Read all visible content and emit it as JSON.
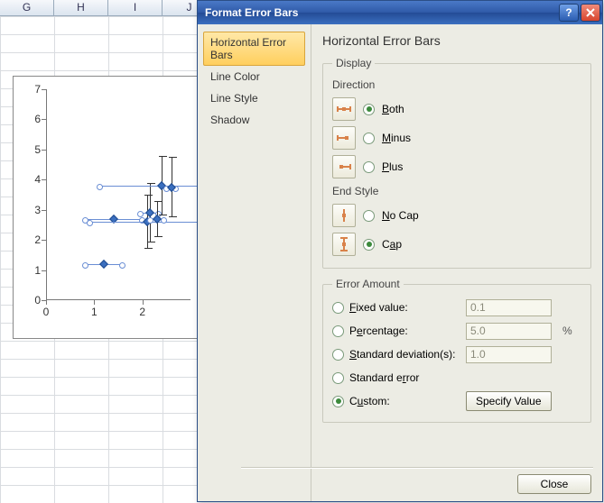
{
  "sheet": {
    "columns": [
      "G",
      "H",
      "I",
      "J"
    ]
  },
  "chart_data": {
    "type": "scatter",
    "xlim": [
      0,
      3
    ],
    "ylim": [
      0,
      7
    ],
    "xticks": [
      0,
      1,
      2
    ],
    "yticks": [
      0,
      1,
      2,
      3,
      4,
      5,
      6,
      7
    ],
    "points": [
      {
        "x": 1.2,
        "y": 1.2,
        "xerr": 0.4,
        "yerr": 0.0
      },
      {
        "x": 1.4,
        "y": 2.7,
        "xerr": 0.6,
        "yerr": 0.0
      },
      {
        "x": 2.1,
        "y": 2.6,
        "xerr": 1.2,
        "yerr": 0.9
      },
      {
        "x": 2.15,
        "y": 2.9,
        "xerr": 0.2,
        "yerr": 1.0
      },
      {
        "x": 2.3,
        "y": 2.7,
        "xerr": 0.15,
        "yerr": 0.6
      },
      {
        "x": 2.4,
        "y": 3.8,
        "xerr": 1.3,
        "yerr": 1.0
      },
      {
        "x": 2.6,
        "y": 3.75,
        "xerr": 0.1,
        "yerr": 1.0
      }
    ]
  },
  "dialog": {
    "title": "Format Error Bars",
    "nav": [
      {
        "id": "h",
        "label": "Horizontal Error Bars",
        "selected": true
      },
      {
        "id": "lc",
        "label": "Line Color",
        "selected": false
      },
      {
        "id": "ls",
        "label": "Line Style",
        "selected": false
      },
      {
        "id": "sh",
        "label": "Shadow",
        "selected": false
      }
    ],
    "panel": {
      "heading": "Horizontal Error Bars",
      "display_legend": "Display",
      "direction_label": "Direction",
      "directions": [
        {
          "id": "both",
          "label": "Both",
          "checked": true
        },
        {
          "id": "minus",
          "label": "Minus",
          "checked": false
        },
        {
          "id": "plus",
          "label": "Plus",
          "checked": false
        }
      ],
      "endstyle_label": "End Style",
      "endstyles": [
        {
          "id": "nocap",
          "label": "No Cap",
          "checked": false
        },
        {
          "id": "cap",
          "label": "Cap",
          "checked": true
        }
      ],
      "amount_legend": "Error Amount",
      "amounts": [
        {
          "id": "fixed",
          "label": "Fixed value:",
          "value": "0.1",
          "checked": false
        },
        {
          "id": "percent",
          "label": "Percentage:",
          "value": "5.0",
          "checked": false,
          "suffix": "%"
        },
        {
          "id": "stdev",
          "label": "Standard deviation(s):",
          "value": "1.0",
          "checked": false
        },
        {
          "id": "stderr",
          "label": "Standard error",
          "checked": false
        },
        {
          "id": "custom",
          "label": "Custom:",
          "checked": true,
          "button": "Specify Value"
        }
      ]
    },
    "close_label": "Close",
    "help_label": "?"
  }
}
